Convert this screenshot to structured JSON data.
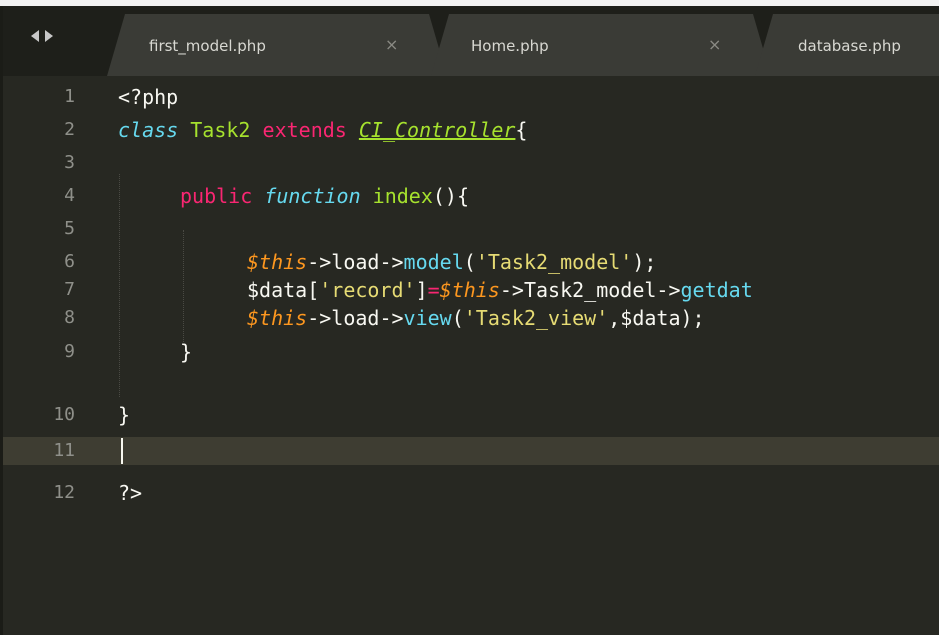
{
  "tabs": [
    {
      "label": "first_model.php",
      "close": "×"
    },
    {
      "label": "Home.php",
      "close": "×"
    },
    {
      "label": "database.php"
    }
  ],
  "lines": [
    {
      "num": "1",
      "tokens": [
        "<?php"
      ]
    },
    {
      "num": "2",
      "tokens": [
        "class",
        " ",
        "Task2",
        " ",
        "extends",
        " ",
        "CI_Controller",
        "{"
      ]
    },
    {
      "num": "3",
      "tokens": []
    },
    {
      "num": "4",
      "tokens": [
        "public",
        " ",
        "function",
        " ",
        "index",
        "(){"
      ]
    },
    {
      "num": "5",
      "tokens": []
    },
    {
      "num": "6",
      "tokens": [
        "$this",
        "->load->",
        "model",
        "(",
        "'Task2_model'",
        ");"
      ]
    },
    {
      "num": "7",
      "tokens": [
        "$data[",
        "'record'",
        "]",
        "=",
        "$this",
        "->Task2_model->",
        "getdat"
      ]
    },
    {
      "num": "8",
      "tokens": [
        "$this",
        "->load->",
        "view",
        "(",
        "'Task2_view'",
        ",$data);"
      ]
    },
    {
      "num": "9",
      "tokens": [
        "}"
      ]
    },
    {
      "num": "10",
      "tokens": [
        "}"
      ]
    },
    {
      "num": "11",
      "tokens": []
    },
    {
      "num": "12",
      "tokens": [
        "?>"
      ]
    }
  ],
  "colors": {
    "background": "#272822",
    "keyword": "#f92672",
    "storage": "#66d9ef",
    "entity": "#a6e22e",
    "variable": "#fd971f",
    "string": "#e6db74",
    "line_number": "#8f908a",
    "current_line": "#3e3d32"
  },
  "icons": {
    "nav": "left-right-arrows-icon",
    "close": "close-icon"
  }
}
